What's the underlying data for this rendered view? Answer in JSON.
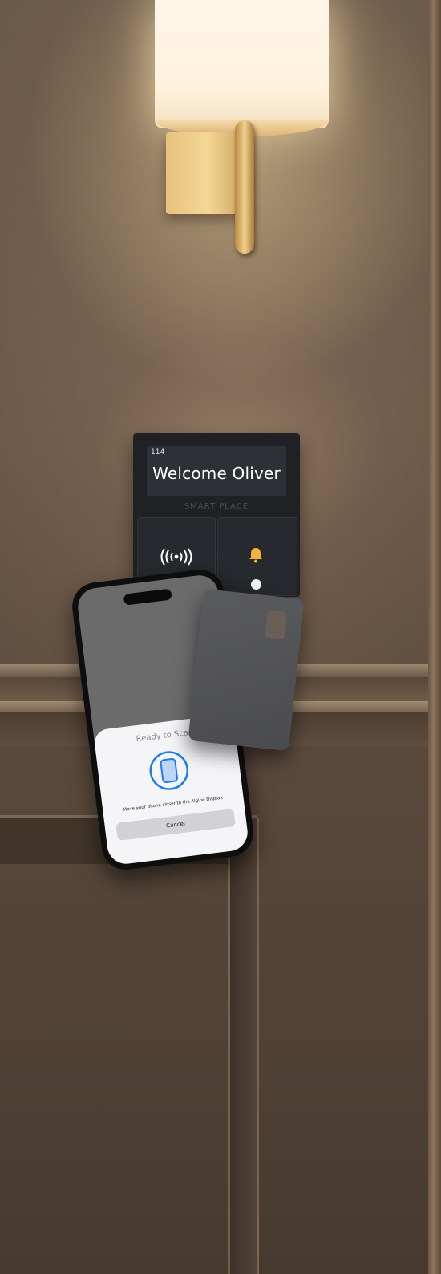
{
  "display": {
    "room_number": "114",
    "welcome_text": "Welcome Oliver",
    "brand": "SMART PLACE",
    "left_button_icon": "nfc-icon",
    "right_button_icon": "bell-icon"
  },
  "phone": {
    "sheet_title": "Ready to Scan",
    "message": "Move your phone closer to the Algine Display.",
    "cancel_label": "Cancel",
    "icon": "phone-scan-icon",
    "accent_color": "#1e7cf2"
  },
  "card": {
    "icon": "key-card"
  }
}
